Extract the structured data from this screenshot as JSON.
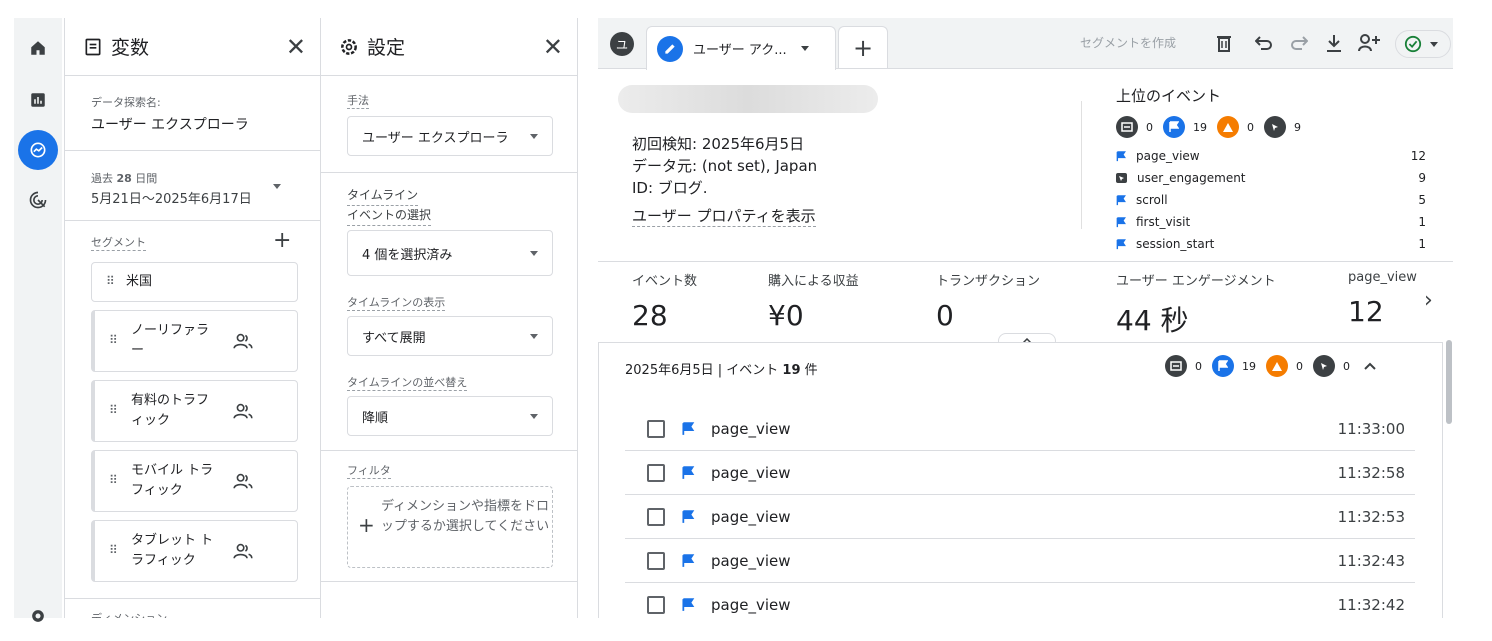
{
  "variables_panel": {
    "title": "変数",
    "exploration_name_label": "データ探索名:",
    "exploration_name": "ユーザー エクスプローラ",
    "date_label_prefix": "過去 ",
    "date_label_days": "28",
    "date_label_suffix": " 日間",
    "date_range": "5月21日～2025年6月17日",
    "segments_label": "セグメント",
    "segments": [
      {
        "label_line1": "米国",
        "label_line2": "",
        "has_user_icon": false
      },
      {
        "label_line1": "ノーリファラ",
        "label_line2": "ー",
        "has_user_icon": true
      },
      {
        "label_line1": "有料のトラフ",
        "label_line2": "ィック",
        "has_user_icon": true
      },
      {
        "label_line1": "モバイル トラ",
        "label_line2": "フィック",
        "has_user_icon": true
      },
      {
        "label_line1": "タブレット ト",
        "label_line2": "ラフィック",
        "has_user_icon": true
      }
    ],
    "dimensions_label_partial": "ディメンション"
  },
  "settings_panel": {
    "title": "設定",
    "technique_label": "手法",
    "technique_value": "ユーザー エクスプローラ",
    "timeline_label": "タイムライン",
    "event_select_label": "イベントの選択",
    "event_select_value": "4 個を選択済み",
    "timeline_display_label": "タイムラインの表示",
    "timeline_display_value": "すべて展開",
    "timeline_sort_label": "タイムラインの並べ替え",
    "timeline_sort_value": "降順",
    "filter_label": "フィルタ",
    "filter_drop_text": "ディメンションや指標をドロップするか選択してください"
  },
  "tabs": {
    "user_badge": "ユ",
    "active_tab_label": "ユーザー アク...",
    "create_segment": "セグメントを作成"
  },
  "user_card": {
    "first_seen": "初回検知: 2025年6月5日",
    "source": "データ元: (not set), Japan",
    "id": "ID: ブログ.",
    "view_properties": "ユーザー プロパティを表示"
  },
  "top_events": {
    "title": "上位のイベント",
    "counts": [
      {
        "icon": "web-page-icon",
        "value": "0",
        "color": "#3c4043"
      },
      {
        "icon": "flag-icon",
        "value": "19",
        "color": "#1a73e8"
      },
      {
        "icon": "warning-icon",
        "value": "0",
        "color": "#f57c00"
      },
      {
        "icon": "pointer-icon",
        "value": "9",
        "color": "#3c4043"
      }
    ],
    "events": [
      {
        "name": "page_view",
        "count": "12",
        "icon": "flag-icon"
      },
      {
        "name": "user_engagement",
        "count": "9",
        "icon": "pointer-icon"
      },
      {
        "name": "scroll",
        "count": "5",
        "icon": "flag-icon"
      },
      {
        "name": "first_visit",
        "count": "1",
        "icon": "flag-icon"
      },
      {
        "name": "session_start",
        "count": "1",
        "icon": "flag-icon"
      }
    ]
  },
  "metrics": [
    {
      "label": "イベント数",
      "value": "28"
    },
    {
      "label": "購入による収益",
      "value": "¥0"
    },
    {
      "label": "トランザクション",
      "value": "0"
    },
    {
      "label": "ユーザー エンゲージメント",
      "value": "44 秒"
    },
    {
      "label": "page_view",
      "value": "12"
    }
  ],
  "day": {
    "title_date": "2025年6月5日",
    "title_sep": " | イベント ",
    "title_count": "19",
    "title_suffix": " 件",
    "counts": [
      "0",
      "19",
      "0",
      "0"
    ],
    "events": [
      {
        "name": "page_view",
        "time": "11:33:00"
      },
      {
        "name": "page_view",
        "time": "11:32:58"
      },
      {
        "name": "page_view",
        "time": "11:32:53"
      },
      {
        "name": "page_view",
        "time": "11:32:43"
      },
      {
        "name": "page_view",
        "time": "11:32:42"
      }
    ]
  },
  "colors": {
    "accent": "#1a73e8",
    "warning": "#f57c00",
    "dark_icon": "#3c4043",
    "success": "#188038"
  }
}
